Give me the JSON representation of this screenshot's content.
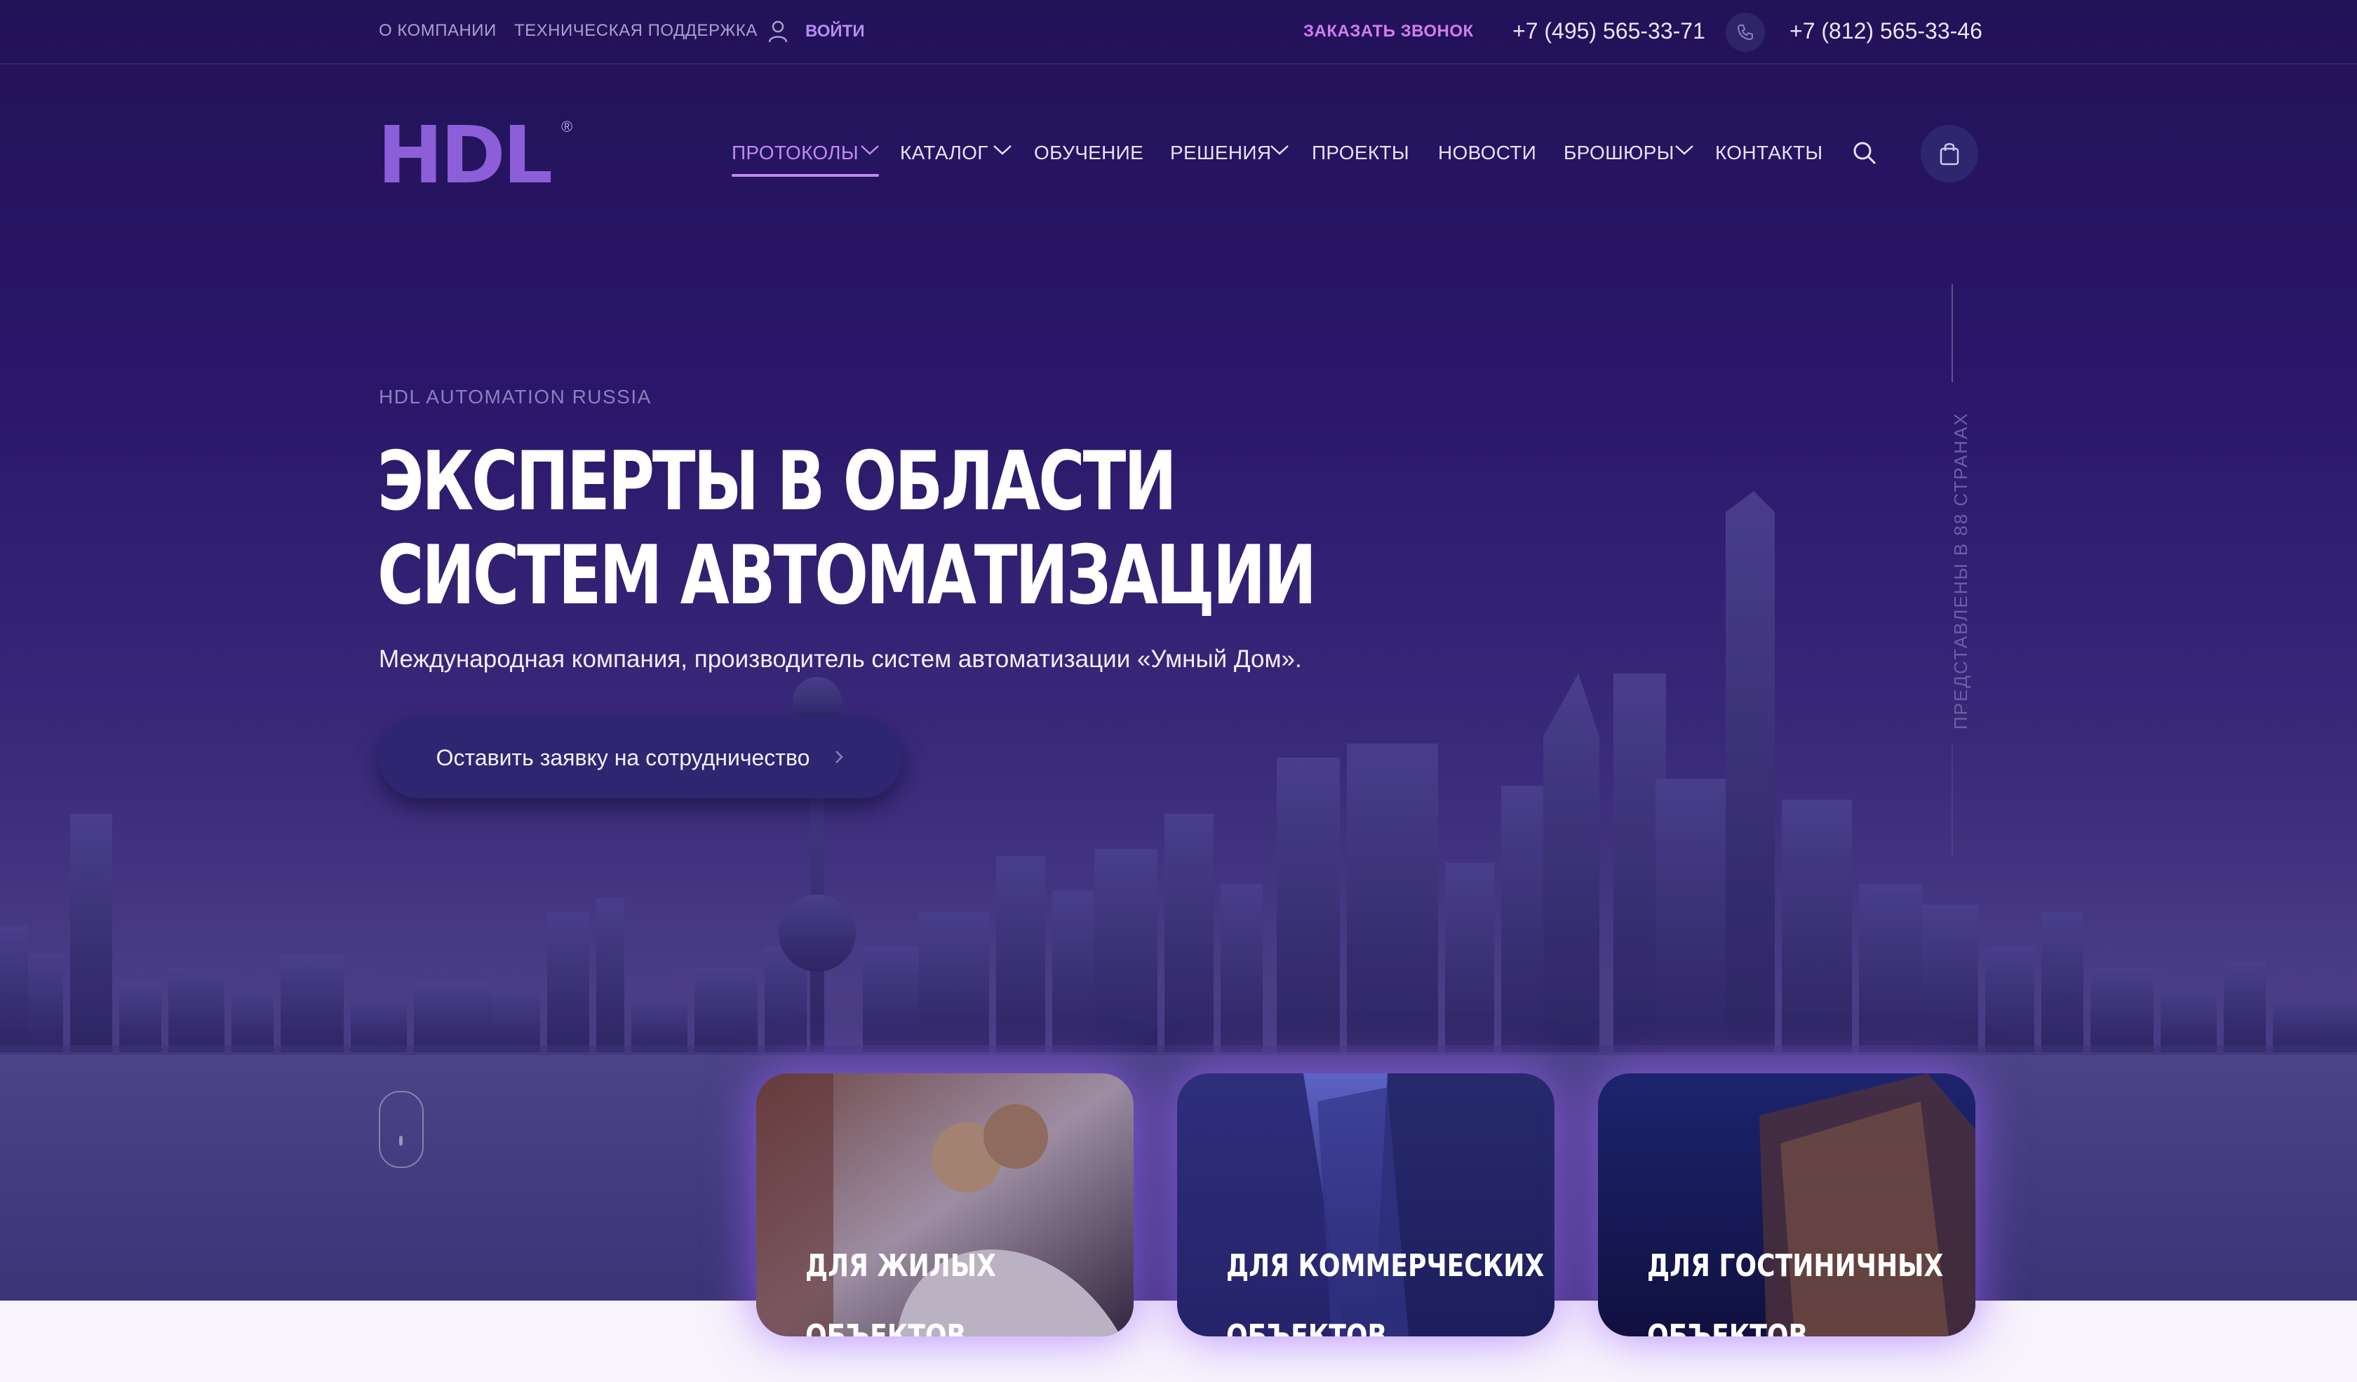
{
  "topbar": {
    "about": "О КОМПАНИИ",
    "support": "ТЕХНИЧЕСКАЯ ПОДДЕРЖКА",
    "login": "ВОЙТИ",
    "callback": "ЗАКАЗАТЬ ЗВОНОК",
    "phone_moscow": "+7 (495) 565-33-71",
    "phone_spb": "+7 (812) 565-33-46"
  },
  "logo": {
    "text": "HDL",
    "mark": "®"
  },
  "nav": {
    "items": [
      {
        "label": "ПРОТОКОЛЫ",
        "active": true,
        "dropdown": true
      },
      {
        "label": "КАТАЛОГ",
        "dropdown": true
      },
      {
        "label": "ОБУЧЕНИЕ"
      },
      {
        "label": "РЕШЕНИЯ",
        "dropdown": true
      },
      {
        "label": "ПРОЕКТЫ"
      },
      {
        "label": "НОВОСТИ"
      },
      {
        "label": "БРОШЮРЫ",
        "dropdown": true
      },
      {
        "label": "КОНТАКТЫ"
      }
    ]
  },
  "hero": {
    "eyebrow": "HDL AUTOMATION RUSSIA",
    "title_line1": "ЭКСПЕРТЫ В ОБЛАСТИ",
    "title_line2": "СИСТЕМ АВТОМАТИЗАЦИИ",
    "subtitle": "Международная компания, производитель систем автоматизации «Умный Дом».",
    "cta": "Оставить заявку на сотрудничество",
    "side_text": "ПРЕДСТАВЛЕНЫ В 88 СТРАНАХ"
  },
  "cards": [
    {
      "line1": "ДЛЯ ЖИЛЫХ",
      "line2": "ОБЪЕКТОВ"
    },
    {
      "line1": "ДЛЯ КОММЕРЧЕСКИХ",
      "line2": "ОБЪЕКТОВ"
    },
    {
      "line1": "ДЛЯ ГОСТИНИЧНЫХ",
      "line2": "ОБЪЕКТОВ"
    }
  ],
  "colors": {
    "brand": "#8c5ed8",
    "accent": "#c08af0",
    "hero_bg": "#221258",
    "cta_bg": "#2e2671"
  },
  "icons": [
    "user-icon",
    "phone-icon",
    "search-icon",
    "cart-icon",
    "chevron-down-icon",
    "chevron-right-icon",
    "scroll-mouse-icon"
  ]
}
